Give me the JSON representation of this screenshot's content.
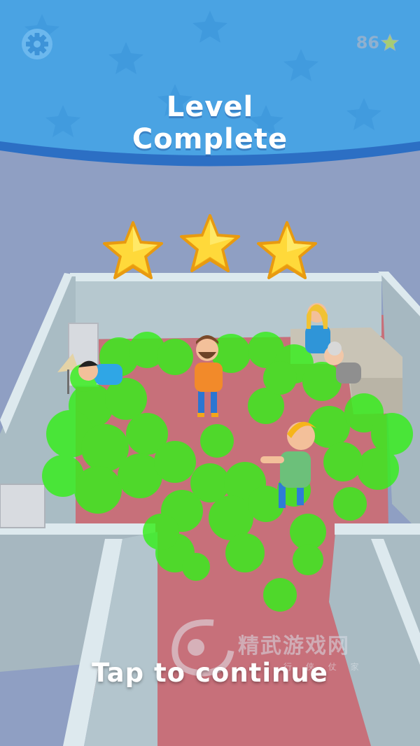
{
  "header": {
    "title_line1": "Level",
    "title_line2": "Complete",
    "coins": "86",
    "settings_icon": "gear-icon",
    "coin_icon": "star-icon"
  },
  "result": {
    "stars_earned": 3,
    "stars_total": 3
  },
  "footer": {
    "tap_label": "Tap to continue"
  },
  "watermark": {
    "main": "精武游戏网",
    "sub": "行 侠 仗 家"
  },
  "colors": {
    "header_blue": "#4aa3e3",
    "header_stripe": "#2e74c9",
    "star_gold": "#ffd93a",
    "gas_green": "#3cf21b",
    "floor": "#c7707a",
    "wall": "#b7c9d0"
  }
}
